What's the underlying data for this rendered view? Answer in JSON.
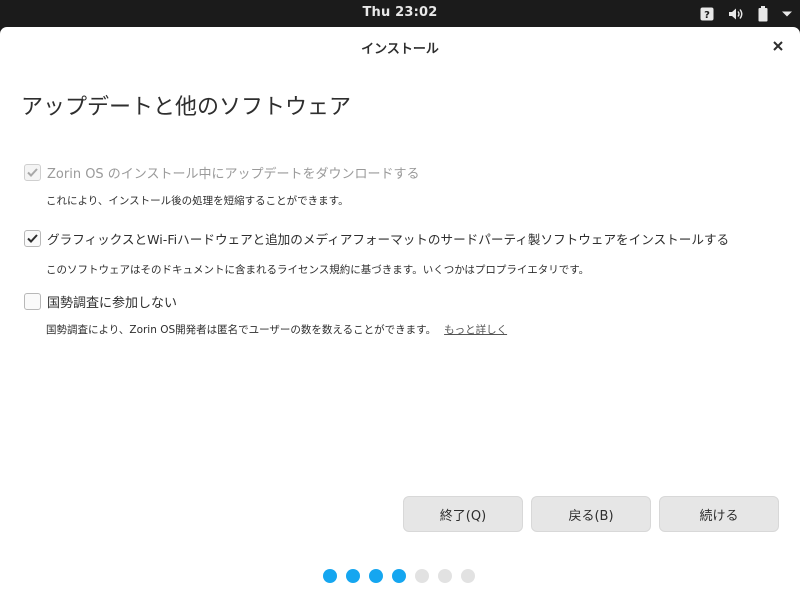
{
  "topbar": {
    "clock": "Thu 23:02",
    "tray": [
      {
        "icon": "help-icon"
      },
      {
        "icon": "volume-icon"
      },
      {
        "icon": "battery-icon"
      },
      {
        "icon": "chevron-down-icon"
      }
    ]
  },
  "window": {
    "title": "インストール",
    "close_icon": "close-icon"
  },
  "page": {
    "title": "アップデートと他のソフトウェア"
  },
  "options": [
    {
      "label": "Zorin OS のインストール中にアップデートをダウンロードする",
      "description": "これにより、インストール後の処理を短縮することができます。",
      "checked": true,
      "disabled": true
    },
    {
      "label": "グラフィックスとWi-Fiハードウェアと追加のメディアフォーマットのサードパーティ製ソフトウェアをインストールする",
      "description": "このソフトウェアはそのドキュメントに含まれるライセンス規約に基づきます。いくつかはプロプライエタリです。",
      "checked": true,
      "disabled": false
    },
    {
      "label": "国勢調査に参加しない",
      "description": "国勢調査により、Zorin OS開発者は匿名でユーザーの数を数えることができます。",
      "link": "もっと詳しく",
      "checked": false,
      "disabled": false
    }
  ],
  "buttons": {
    "quit": "終了(Q)",
    "back": "戻る(B)",
    "continue": "続ける"
  },
  "progress": {
    "total_steps": 7,
    "completed_steps": 4
  },
  "colors": {
    "accent": "#15a6f0",
    "topbar": "#1b1b1b",
    "button": "#e6e6e6"
  }
}
